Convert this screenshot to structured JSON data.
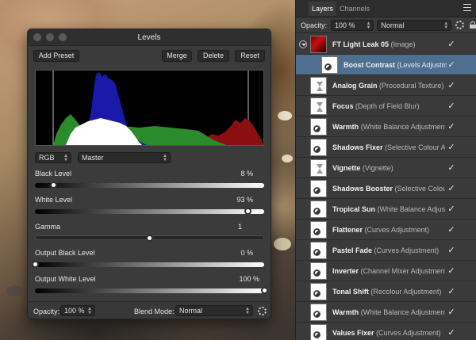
{
  "levels": {
    "title": "Levels",
    "buttons": {
      "add_preset": "Add Preset",
      "merge": "Merge",
      "delete": "Delete",
      "reset": "Reset"
    },
    "channel": "RGB",
    "preset": "Master",
    "sliders": [
      {
        "label": "Black Level",
        "value": "8 %",
        "position": 0.08
      },
      {
        "label": "White Level",
        "value": "93 %",
        "position": 0.93
      },
      {
        "label": "Gamma",
        "value": "1",
        "position": 0.5
      },
      {
        "label": "Output Black Level",
        "value": "0 %",
        "position": 0.0
      },
      {
        "label": "Output White Level",
        "value": "100 %",
        "position": 1.0
      }
    ],
    "footer": {
      "opacity_label": "Opacity:",
      "opacity_value": "100 %",
      "blend_label": "Blend Mode:",
      "blend_value": "Normal"
    }
  },
  "layers_panel": {
    "tabs": [
      "Layers",
      "Channels"
    ],
    "opacity_label": "Opacity:",
    "opacity_value": "100 %",
    "blend_value": "Normal",
    "layers": [
      {
        "name": "FT Light Leak 05",
        "type": "(Image)",
        "kind": "image",
        "checked": true
      },
      {
        "name": "Boost Contrast",
        "type": "(Levels Adjustment)",
        "kind": "adjustment",
        "child": true,
        "selected": true,
        "checked": true
      },
      {
        "name": "Analog Grain",
        "type": "(Procedural Texture)",
        "kind": "live-filter",
        "checked": true
      },
      {
        "name": "Focus",
        "type": "(Depth of Field Blur)",
        "kind": "live-filter",
        "checked": true
      },
      {
        "name": "Warmth",
        "type": "(White Balance Adjustment)",
        "kind": "adjustment",
        "checked": true
      },
      {
        "name": "Shadows Fixer",
        "type": "(Selective Colour Adjustment)",
        "kind": "adjustment",
        "checked": true
      },
      {
        "name": "Vignette",
        "type": "(Vignette)",
        "kind": "live-filter",
        "checked": true
      },
      {
        "name": "Shadows Booster",
        "type": "(Selective Colour Adjustment)",
        "kind": "adjustment",
        "checked": true
      },
      {
        "name": "Tropical Sun",
        "type": "(White Balance Adjustment)",
        "kind": "adjustment",
        "checked": true
      },
      {
        "name": "Flattener",
        "type": "(Curves Adjustment)",
        "kind": "adjustment",
        "checked": true
      },
      {
        "name": "Pastel Fade",
        "type": "(Curves Adjustment)",
        "kind": "adjustment",
        "checked": true
      },
      {
        "name": "Inverter",
        "type": "(Channel Mixer Adjustment)",
        "kind": "adjustment",
        "checked": true
      },
      {
        "name": "Tonal Shift",
        "type": "(Recolour Adjustment)",
        "kind": "adjustment",
        "checked": true
      },
      {
        "name": "Warmth",
        "type": "(White Balance Adjustment)",
        "kind": "adjustment",
        "checked": true
      },
      {
        "name": "Values Fixer",
        "type": "(Curves Adjustment)",
        "kind": "adjustment",
        "checked": true
      }
    ]
  },
  "icons": {
    "check": "✓",
    "menu": "hamburger-icon",
    "gear": "gear-icon",
    "lock": "lock-icon"
  }
}
